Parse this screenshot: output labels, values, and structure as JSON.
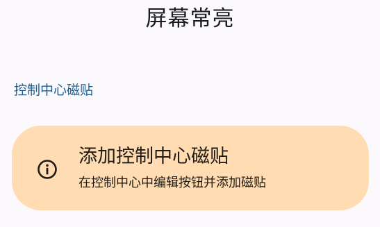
{
  "header": {
    "title": "屏幕常亮"
  },
  "section": {
    "label": "控制中心磁贴"
  },
  "info_card": {
    "icon": "info-icon",
    "title": "添加控制中心磁贴",
    "subtitle": "在控制中心中编辑按钮并添加磁贴",
    "background": "#ffdcb2"
  },
  "colors": {
    "page_background": "#fcf9fd",
    "section_accent": "#1e5f8f",
    "text_primary": "#1b1b1f"
  }
}
